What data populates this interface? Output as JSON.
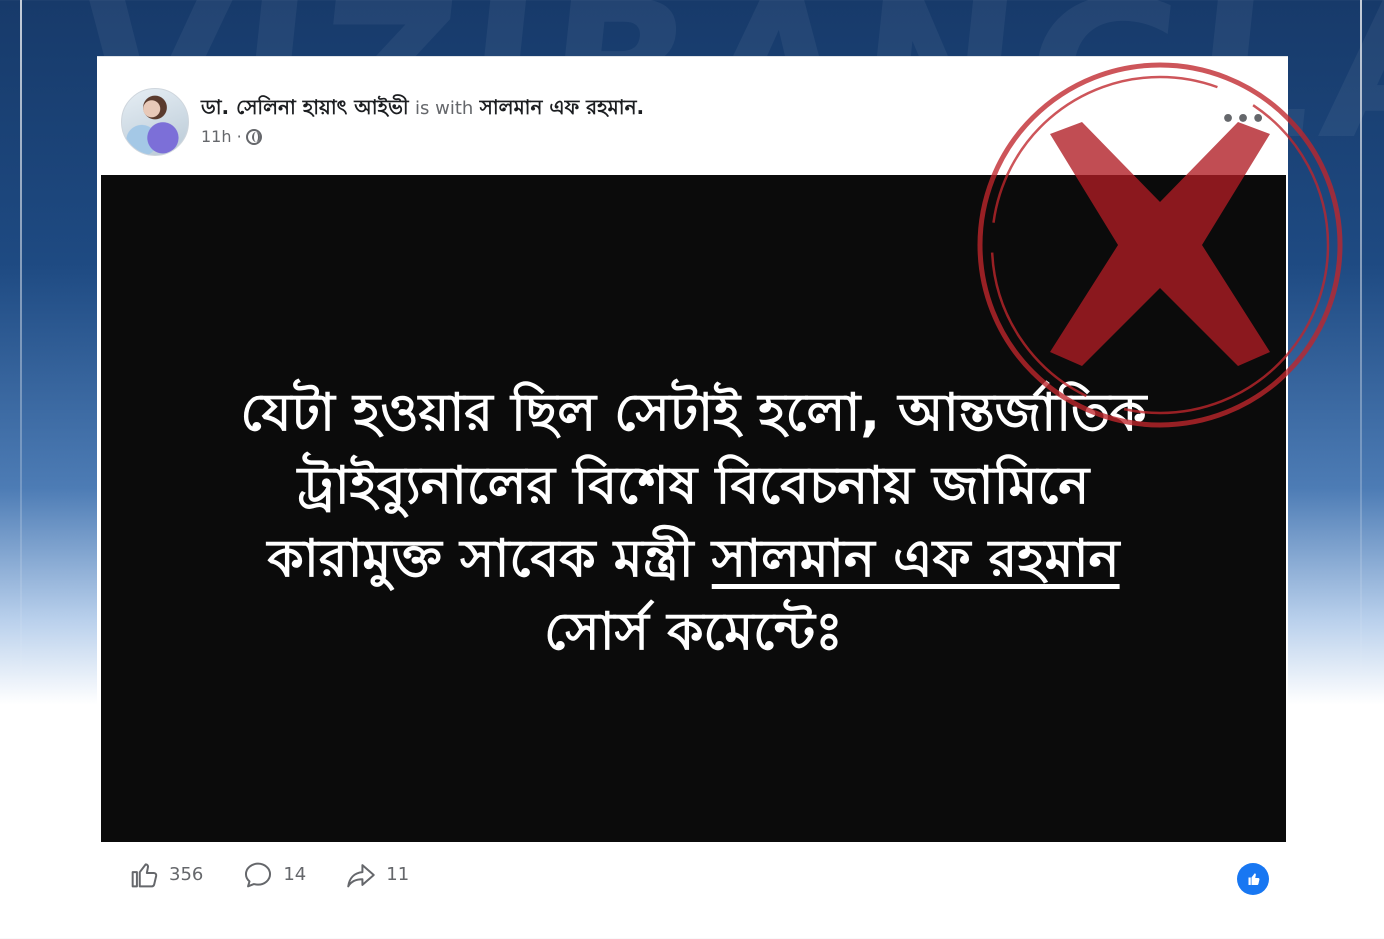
{
  "post": {
    "author": "ডা. সেলিনা হায়াৎ আইভী",
    "with_text": "is with",
    "tagged_person": "সালমান এফ রহমান.",
    "time": "11h ·",
    "image_text": {
      "line1": "যেটা হওয়ার ছিল সেটাই হলো, আন্তর্জাতিক",
      "line2": "ট্রাইব্যুনালের বিশেষ বিবেচনায় জামিনে",
      "line3_prefix": "কারামুক্ত সাবেক মন্ত্রী ",
      "line3_underlined": "সালমান এফ রহমান",
      "line4": "সোর্স কমেন্টেঃ"
    },
    "stats": {
      "likes": "356",
      "comments": "14",
      "shares": "11"
    }
  },
  "icons": {
    "more": "more-options-icon",
    "privacy": "globe-icon",
    "like": "thumbs-up-icon",
    "comment": "comment-bubble-icon",
    "share": "share-arrow-icon",
    "reaction": "like-reaction-icon"
  },
  "colors": {
    "stamp_red": "#c0262c",
    "facebook_blue": "#1877f2",
    "background_navy": "#1e4a82"
  }
}
